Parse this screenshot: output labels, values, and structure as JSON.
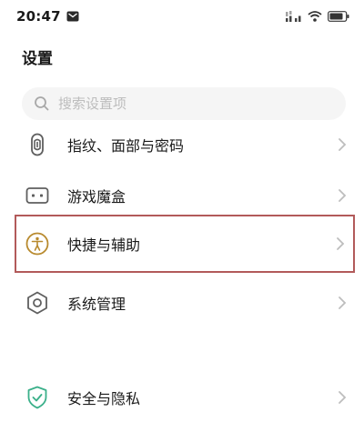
{
  "status_bar": {
    "time": "20:47",
    "icons": [
      "message-icon",
      "signal-icon",
      "wifi-icon",
      "battery-icon"
    ]
  },
  "page": {
    "title": "设置"
  },
  "search": {
    "placeholder": "搜索设置项"
  },
  "menu": {
    "items": [
      {
        "label": "指纹、面部与密码",
        "icon": "fingerprint-icon"
      },
      {
        "label": "游戏魔盒",
        "icon": "game-box-icon"
      },
      {
        "label": "快捷与辅助",
        "icon": "accessibility-icon"
      },
      {
        "label": "系统管理",
        "icon": "system-icon"
      },
      {
        "label": "安全与隐私",
        "icon": "shield-icon"
      }
    ]
  },
  "colors": {
    "icon_gray": "#5f5f5f",
    "highlight_border": "#b25a5a",
    "accessibility_gold": "#b88a2e",
    "shield_green": "#3bb08a",
    "chevron": "#bdbdbd"
  }
}
